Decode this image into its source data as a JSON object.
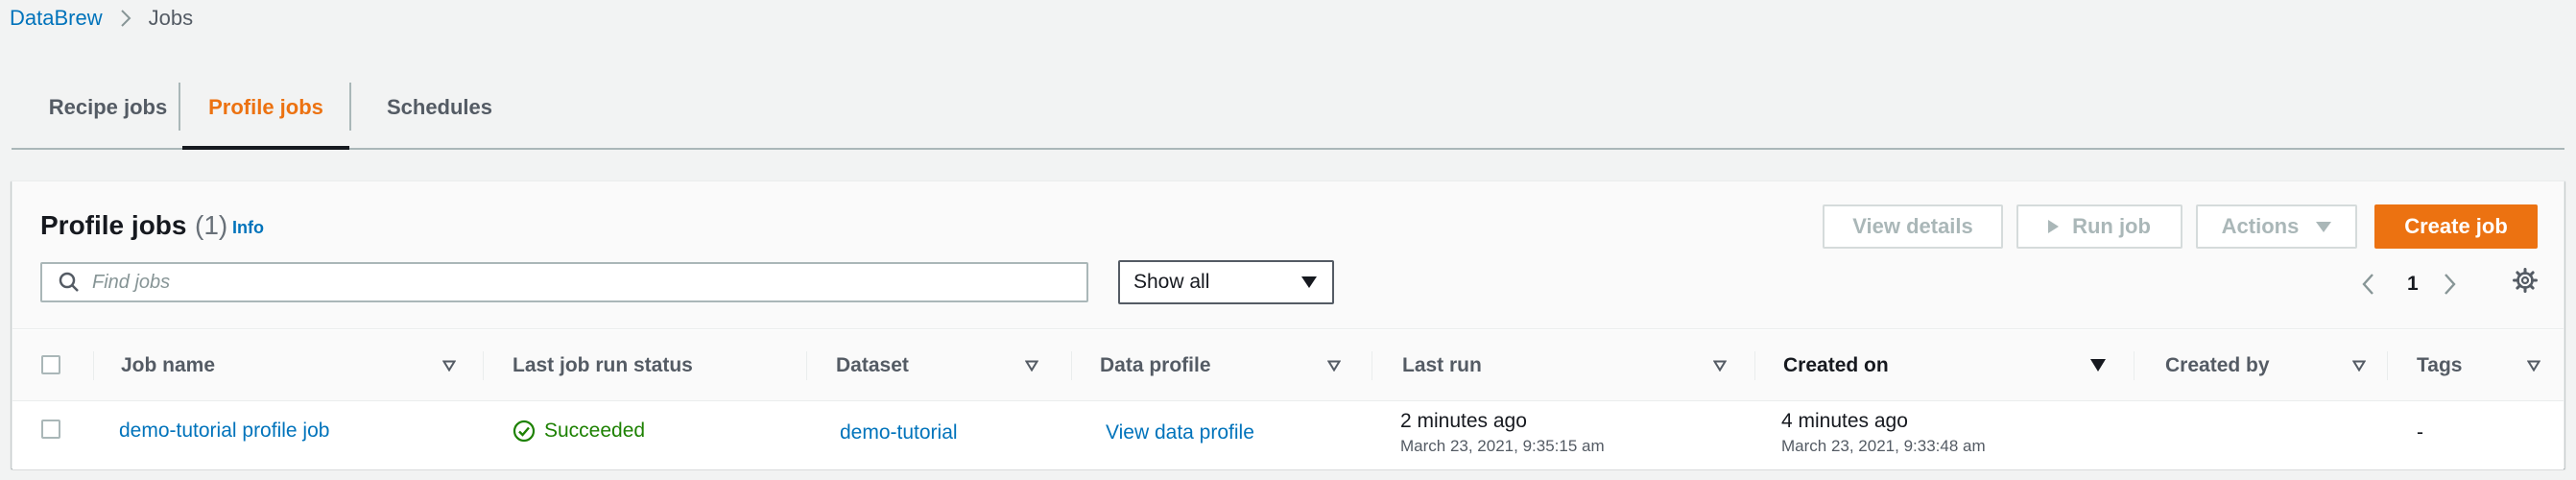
{
  "breadcrumb": {
    "root": "DataBrew",
    "current": "Jobs"
  },
  "tabs": [
    {
      "label": "Recipe jobs",
      "active": false
    },
    {
      "label": "Profile jobs",
      "active": true
    },
    {
      "label": "Schedules",
      "active": false
    }
  ],
  "panel": {
    "title": "Profile jobs",
    "count": "(1)",
    "info": "Info",
    "buttons": {
      "view_details": "View details",
      "run_job": "Run job",
      "actions": "Actions",
      "create_job": "Create job"
    },
    "search": {
      "placeholder": "Find jobs",
      "value": ""
    },
    "filter": {
      "selected": "Show all"
    },
    "pagination": {
      "page": "1"
    }
  },
  "table": {
    "columns": [
      "Job name",
      "Last job run status",
      "Dataset",
      "Data profile",
      "Last run",
      "Created on",
      "Created by",
      "Tags"
    ],
    "sorted_column": "Created on",
    "rows": [
      {
        "job_name": "demo-tutorial profile job",
        "status": "Succeeded",
        "dataset": "demo-tutorial",
        "data_profile": "View data profile",
        "last_run_relative": "2 minutes ago",
        "last_run_date": "March 23, 2021, 9:35:15 am",
        "created_relative": "4 minutes ago",
        "created_date": "March 23, 2021, 9:33:48 am",
        "created_by": "",
        "tags": "-"
      }
    ]
  },
  "colors": {
    "accent": "#ec7211",
    "link": "#0073bb",
    "success": "#1d8102",
    "text": "#16191f",
    "muted": "#545b64"
  }
}
